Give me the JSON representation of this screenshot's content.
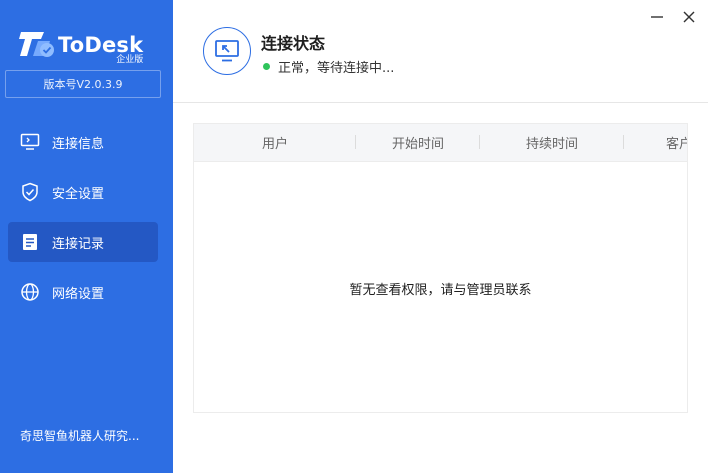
{
  "app": {
    "title": "ToDesk",
    "edition": "企业版",
    "version": "版本号V2.0.3.9",
    "brand_color": "#2d6ee3"
  },
  "sidebar": {
    "items": [
      {
        "label": "连接信息",
        "icon": "monitor-icon",
        "active": false
      },
      {
        "label": "安全设置",
        "icon": "shield-check-icon",
        "active": false
      },
      {
        "label": "连接记录",
        "icon": "document-icon",
        "active": true
      },
      {
        "label": "网络设置",
        "icon": "globe-icon",
        "active": false
      }
    ],
    "company": "奇思智鱼机器人研究..."
  },
  "header": {
    "title": "连接状态",
    "status_text": "正常，等待连接中...",
    "status_color": "#2fc45b"
  },
  "window": {
    "minimize_icon": "minimize-icon",
    "close_icon": "close-icon"
  },
  "table": {
    "columns": [
      "用户",
      "开始时间",
      "持续时间",
      "客户"
    ],
    "empty_message": "暂无查看权限，请与管理员联系"
  }
}
